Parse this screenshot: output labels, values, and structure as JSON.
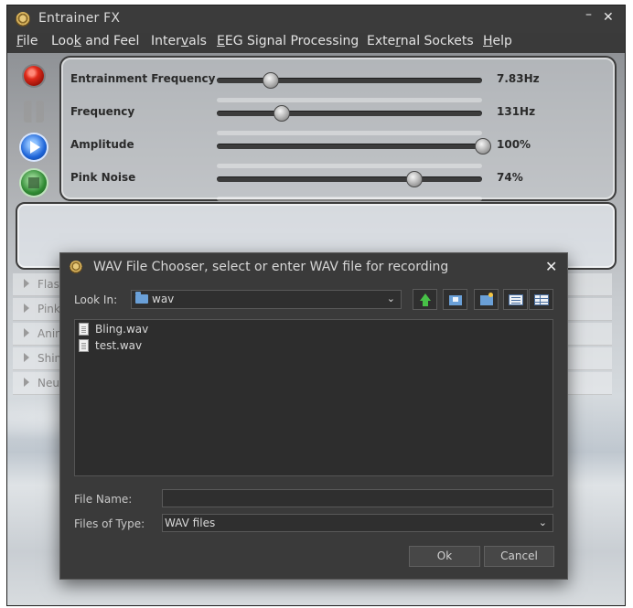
{
  "window": {
    "title": "Entrainer FX",
    "minimize": "–",
    "close": "✕"
  },
  "menu": [
    {
      "label": "File"
    },
    {
      "label": "Look and Feel"
    },
    {
      "label": "Intervals"
    },
    {
      "label": "EEG Signal Processing"
    },
    {
      "label": "External Sockets"
    },
    {
      "label": "Help"
    }
  ],
  "controls": {
    "sliders": [
      {
        "label": "Entrainment Frequency",
        "value": "7.83Hz",
        "position": 0.2
      },
      {
        "label": "Frequency",
        "value": "131Hz",
        "position": 0.24
      },
      {
        "label": "Amplitude",
        "value": "100%",
        "position": 1.0
      },
      {
        "label": "Pink Noise",
        "value": "74%",
        "position": 0.74
      }
    ]
  },
  "side_panels": [
    {
      "label": "Flas"
    },
    {
      "label": "Pink"
    },
    {
      "label": "Anin"
    },
    {
      "label": "Shin"
    },
    {
      "label": "Neu"
    }
  ],
  "dialog": {
    "title": "WAV File Chooser, select or enter WAV file for recording",
    "close": "✕",
    "look_in_label": "Look In:",
    "look_in_value": "wav",
    "files": [
      "Bling.wav",
      "test.wav"
    ],
    "file_name_label": "File Name:",
    "file_name_value": "",
    "files_of_type_label": "Files of Type:",
    "files_of_type_value": "WAV files",
    "ok_label": "Ok",
    "cancel_label": "Cancel"
  },
  "icons": {
    "record": "record-icon",
    "pause": "pause-icon",
    "play": "play-icon",
    "stop": "stop-icon"
  }
}
